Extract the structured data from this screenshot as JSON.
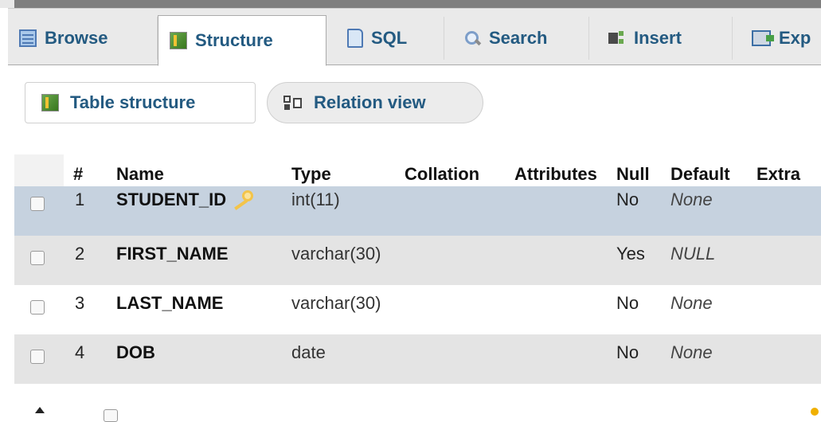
{
  "tabs": [
    {
      "label": "Browse",
      "icon": "browse-icon"
    },
    {
      "label": "Structure",
      "icon": "structure-icon",
      "active": true
    },
    {
      "label": "SQL",
      "icon": "sql-icon"
    },
    {
      "label": "Search",
      "icon": "search-icon"
    },
    {
      "label": "Insert",
      "icon": "insert-icon"
    },
    {
      "label": "Exp",
      "icon": "export-icon"
    }
  ],
  "subtabs": [
    {
      "label": "Table structure",
      "icon": "table-structure-icon",
      "active": true
    },
    {
      "label": "Relation view",
      "icon": "relation-view-icon"
    }
  ],
  "table": {
    "headers": {
      "num": "#",
      "name": "Name",
      "type": "Type",
      "collation": "Collation",
      "attributes": "Attributes",
      "null": "Null",
      "default": "Default",
      "extra": "Extra"
    },
    "rows": [
      {
        "num": "1",
        "name": "STUDENT_ID",
        "primary_key": true,
        "type": "int(11)",
        "collation": "",
        "attributes": "",
        "null": "No",
        "default": "None",
        "extra": ""
      },
      {
        "num": "2",
        "name": "FIRST_NAME",
        "primary_key": false,
        "type": "varchar(30)",
        "collation": "",
        "attributes": "",
        "null": "Yes",
        "default": "NULL",
        "extra": ""
      },
      {
        "num": "3",
        "name": "LAST_NAME",
        "primary_key": false,
        "type": "varchar(30)",
        "collation": "",
        "attributes": "",
        "null": "No",
        "default": "None",
        "extra": ""
      },
      {
        "num": "4",
        "name": "DOB",
        "primary_key": false,
        "type": "date",
        "collation": "",
        "attributes": "",
        "null": "No",
        "default": "None",
        "extra": ""
      }
    ]
  },
  "colors": {
    "link": "#235a81",
    "tab_bar": "#eaeaea",
    "row_selected": "#c6d2df",
    "row_shade": "#e4e4e4",
    "key": "#f3c44a"
  }
}
